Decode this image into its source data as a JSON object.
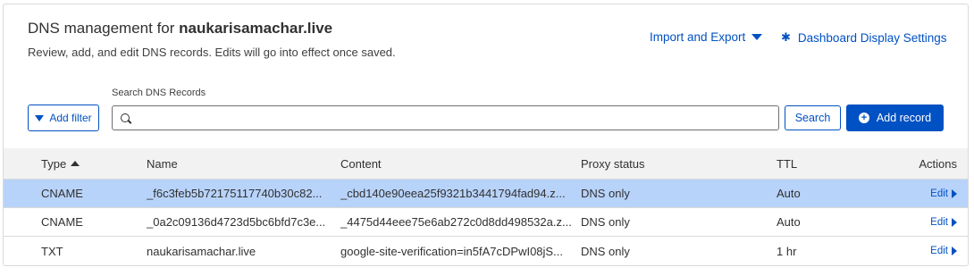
{
  "header": {
    "title_prefix": "DNS management for",
    "domain": "naukarisamachar.live",
    "subtitle": "Review, add, and edit DNS records. Edits will go into effect once saved.",
    "import_export_label": "Import and Export",
    "dashboard_settings_label": "Dashboard Display Settings"
  },
  "controls": {
    "add_filter_label": "Add filter",
    "search_label": "Search DNS Records",
    "search_value": "",
    "search_button_label": "Search",
    "add_record_label": "Add record"
  },
  "table": {
    "columns": {
      "type": "Type",
      "name": "Name",
      "content": "Content",
      "proxy": "Proxy status",
      "ttl": "TTL",
      "actions": "Actions"
    },
    "rows": [
      {
        "type": "CNAME",
        "name": "_f6c3feb5b72175117740b30c82...",
        "content": "_cbd140e90eea25f9321b3441794fad94.z...",
        "proxy": "DNS only",
        "ttl": "Auto",
        "action": "Edit",
        "selected": true
      },
      {
        "type": "CNAME",
        "name": "_0a2c09136d4723d5bc6bfd7c3e...",
        "content": "_4475d44eee75e6ab272c0d8dd498532a.z...",
        "proxy": "DNS only",
        "ttl": "Auto",
        "action": "Edit",
        "selected": false
      },
      {
        "type": "TXT",
        "name": "naukarisamachar.live",
        "content": "google-site-verification=in5fA7cDPwI08jS...",
        "proxy": "DNS only",
        "ttl": "1 hr",
        "action": "Edit",
        "selected": false
      }
    ]
  },
  "colors": {
    "accent": "#0051c3",
    "selected_row": "#b8d3fa",
    "header_bg": "#f2f2f2"
  },
  "icons": {
    "import_export": "caret-down-icon",
    "dashboard_settings": "gear-icon",
    "add_filter": "filter-icon",
    "search": "search-icon",
    "add_record": "plus-circle-icon",
    "sort": "sort-ascending-icon",
    "edit": "caret-right-icon"
  }
}
